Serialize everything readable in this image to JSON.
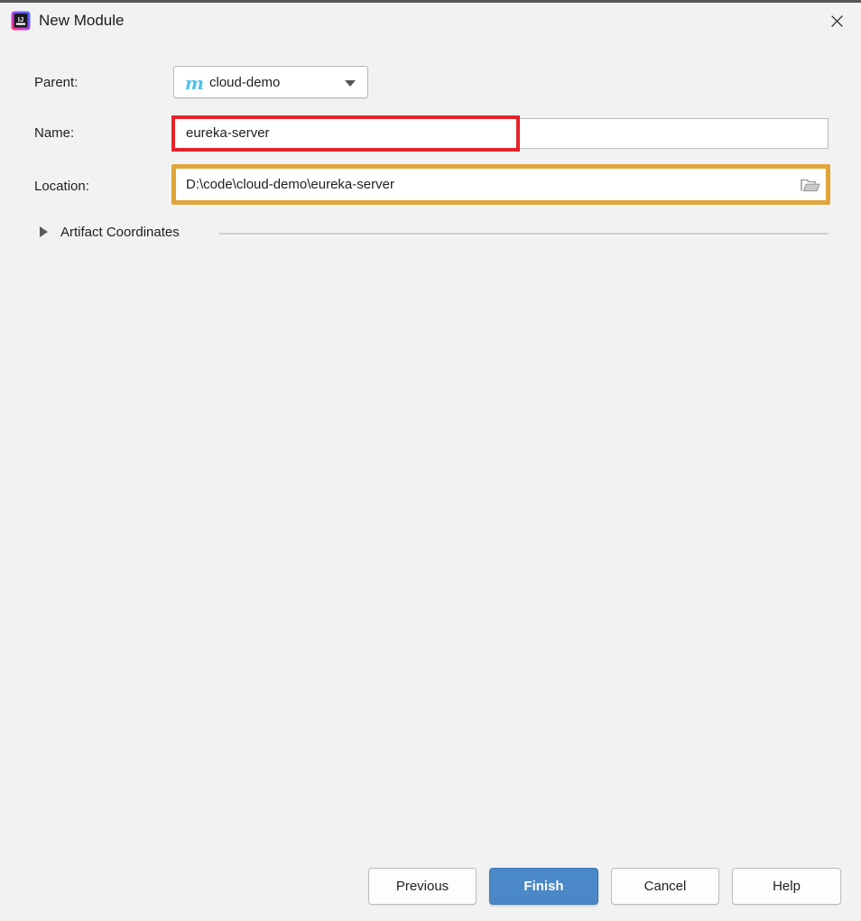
{
  "window": {
    "title": "New Module",
    "app_icon": "intellij-idea-icon",
    "close_icon": "close-icon"
  },
  "form": {
    "parent": {
      "label": "Parent:",
      "icon": "maven-module-icon",
      "icon_glyph": "m",
      "value": "cloud-demo",
      "dropdown_icon": "chevron-down-icon"
    },
    "name": {
      "label": "Name:",
      "value": "eureka-server",
      "placeholder": ""
    },
    "location": {
      "label": "Location:",
      "value": "D:\\code\\cloud-demo\\eureka-server",
      "placeholder": "",
      "browse_icon": "folder-icon"
    }
  },
  "artifact_section": {
    "label": "Artifact Coordinates",
    "expanded": false,
    "disclosure_icon": "triangle-right-icon"
  },
  "buttons": {
    "previous": "Previous",
    "finish": "Finish",
    "cancel": "Cancel",
    "help": "Help"
  },
  "annotations": {
    "name_highlight_color": "#e8222a",
    "location_highlight_color": "#e0a53a"
  },
  "colors": {
    "background": "#f2f2f2",
    "primary_button": "#4a88c7",
    "maven_icon": "#4fc3e8",
    "field_background": "#ffffff"
  }
}
